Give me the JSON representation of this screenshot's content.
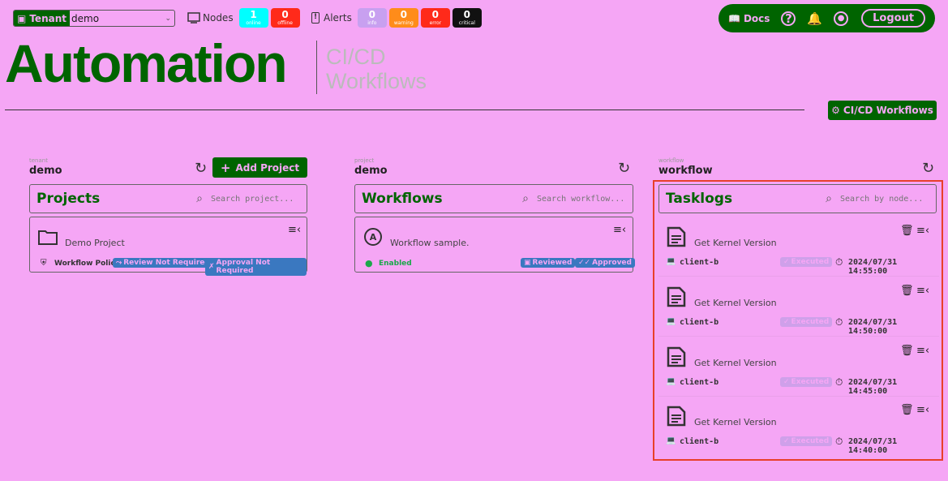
{
  "topbar": {
    "tenant_label": "Tenant",
    "tenant_value": "demo",
    "nodes_label": "Nodes",
    "nodes": [
      {
        "count": "1",
        "label": "online",
        "color": "#00ffff"
      },
      {
        "count": "0",
        "label": "offline",
        "color": "#ff2a1a"
      }
    ],
    "alerts_label": "Alerts",
    "alerts": [
      {
        "count": "0",
        "label": "info",
        "color": "#c8a0f0"
      },
      {
        "count": "0",
        "label": "warning",
        "color": "#ff8c1a"
      },
      {
        "count": "0",
        "label": "error",
        "color": "#ff2a1a"
      },
      {
        "count": "0",
        "label": "critical",
        "color": "#111111"
      }
    ],
    "docs_label": "Docs",
    "logout_label": "Logout"
  },
  "header": {
    "title": "Automation",
    "subtitle_line1": "CI/CD",
    "subtitle_line2": "Workflows",
    "cicd_button": "CI/CD Workflows"
  },
  "columns": {
    "projects": {
      "small_label": "tenant",
      "context": "demo",
      "add_label": "Add Project",
      "title": "Projects",
      "search_placeholder": "Search project...",
      "card": {
        "name": "Demo Project",
        "policy": "Workflow Policy",
        "tag1": "Review Not Required",
        "tag2": "Approval Not Required"
      }
    },
    "workflows": {
      "small_label": "project",
      "context": "demo",
      "title": "Workflows",
      "search_placeholder": "Search workflow...",
      "card": {
        "name": "Workflow sample.",
        "status": "Enabled",
        "tag1": "Reviewed",
        "tag2": "Approved"
      }
    },
    "tasklogs": {
      "small_label": "workflow",
      "context": "workflow",
      "title": "Tasklogs",
      "search_placeholder": "Search by node...",
      "items": [
        {
          "name": "Get Kernel Version",
          "node": "client-b",
          "status": "Executed",
          "time": "2024/07/31 14:55:00"
        },
        {
          "name": "Get Kernel Version",
          "node": "client-b",
          "status": "Executed",
          "time": "2024/07/31 14:50:00"
        },
        {
          "name": "Get Kernel Version",
          "node": "client-b",
          "status": "Executed",
          "time": "2024/07/31 14:45:00"
        },
        {
          "name": "Get Kernel Version",
          "node": "client-b",
          "status": "Executed",
          "time": "2024/07/31 14:40:00"
        }
      ]
    }
  }
}
